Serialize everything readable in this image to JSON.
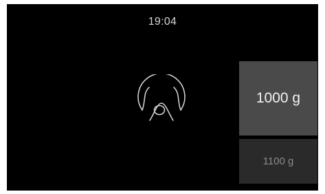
{
  "status_bar": {
    "time": "19:04"
  },
  "program": {
    "icon": "meat-roast-icon"
  },
  "weight_selector": {
    "selected_value": "1000 g",
    "next_value": "1100 g"
  },
  "colors": {
    "background": "#000000",
    "selected_tile": "#4a4a4a",
    "unselected_tile": "#2a2a2a",
    "icon_stroke": "#cfcfcf"
  }
}
